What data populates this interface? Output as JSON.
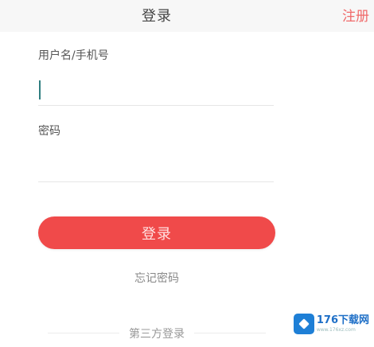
{
  "header": {
    "title": "登录",
    "register_label": "注册"
  },
  "form": {
    "username_label": "用户名/手机号",
    "username_value": "",
    "password_label": "密码",
    "password_value": ""
  },
  "actions": {
    "login_label": "登录",
    "forgot_label": "忘记密码",
    "third_party_label": "第三方登录"
  },
  "watermark": {
    "brand": "176下载网",
    "site": "www.176xz.com"
  },
  "colors": {
    "accent": "#f04a4a",
    "register": "#f06a6a",
    "brand": "#1e7fd6"
  }
}
